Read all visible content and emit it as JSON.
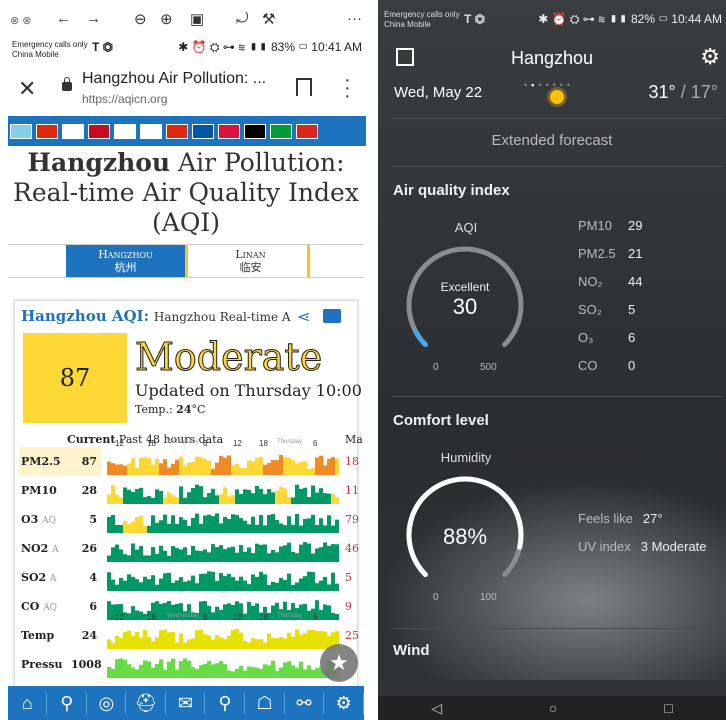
{
  "left": {
    "status": {
      "carrier_line1": "Emergency calls only",
      "carrier_line2": "China Mobile",
      "icons": "T ⏣",
      "right": "✱ ⏰ ⛭ ⊶ ≋ ▮▮ 83% ▭ 10:41 AM"
    },
    "address": {
      "title": "Hangzhou Air Pollution: ...",
      "url": "https://aqicn.org"
    },
    "flag_colors": [
      "#87ceeb",
      "#de2910",
      "#ffffff",
      "#c60b1e",
      "#ffffff",
      "#ffffff",
      "#de2910",
      "#0055a4",
      "#dc143c",
      "#000000",
      "#009c3b",
      "#da251d"
    ],
    "heading_bold": "Hangzhou",
    "heading_rest": " Air Pollution: Real-time Air Quality Index (AQI)",
    "tabs": [
      {
        "en": "Hangzhou",
        "zh": "杭州"
      },
      {
        "en": "Linan",
        "zh": "临安"
      }
    ],
    "card": {
      "title": "Hangzhou AQI:",
      "subtitle": "Hangzhou Real-time A",
      "aqi": "87",
      "level": "Moderate",
      "updated": "Updated on Thursday 10:00",
      "temp_label": "Temp.: ",
      "temp_value": "24",
      "temp_unit": "°C",
      "hist_current": "Current",
      "hist_label": "Past 48 hours data",
      "hist_max": "Ma",
      "hours": [
        "12",
        "18",
        "Wednesday",
        "6",
        "12",
        "18",
        "Thursday",
        "6"
      ],
      "rows": [
        {
          "name": "PM2.5",
          "sub": "",
          "value": "87",
          "max": "18",
          "color": "#f39c12",
          "bg": "#fff3cd"
        },
        {
          "name": "PM10",
          "sub": "",
          "value": "28",
          "max": "11",
          "color": "#009966",
          "bg": "#ffffff"
        },
        {
          "name": "O3",
          "sub": "AQ",
          "value": "5",
          "max": "79",
          "color": "#009966",
          "bg": "#ffffff"
        },
        {
          "name": "NO2",
          "sub": "A",
          "value": "26",
          "max": "46",
          "color": "#009966",
          "bg": "#ffffff"
        },
        {
          "name": "SO2",
          "sub": "A",
          "value": "4",
          "max": "5",
          "color": "#009966",
          "bg": "#ffffff"
        },
        {
          "name": "CO",
          "sub": "AQ",
          "value": "6",
          "max": "9",
          "color": "#009966",
          "bg": "#ffffff"
        },
        {
          "name": "Temp",
          "sub": "",
          "value": "24",
          "max": "25",
          "color": "#e8e000",
          "bg": "#ffffff"
        },
        {
          "name": "Pressu",
          "sub": "",
          "value": "1008",
          "max": "",
          "color": "#66dd44",
          "bg": "#ffffff"
        }
      ]
    },
    "bottom_icons": [
      "home-icon",
      "map-pin-icon",
      "globe-icon",
      "mask-icon",
      "faq-icon",
      "search-icon",
      "chat-icon",
      "link-icon",
      "gear-icon"
    ]
  },
  "right": {
    "status": {
      "carrier_line1": "Emergency calls only",
      "carrier_line2": "China Mobile",
      "icons": "T ⏣",
      "right": "✱ ⏰ ⛭ ⊶ ≋ ▮▮ 82% ▭ 10:44 AM"
    },
    "city": "Hangzhou",
    "date": "Wed, May 22",
    "high": "31°",
    "low": " / 17°",
    "extended": "Extended forecast",
    "aqi_section": "Air quality index",
    "aqi_title": "AQI",
    "aqi_level": "Excellent",
    "aqi_value": "30",
    "aqi_min": "0",
    "aqi_max": "500",
    "aqi_fraction": 0.06,
    "pollutants": [
      {
        "k": "PM10",
        "v": "29"
      },
      {
        "k": "PM2.5",
        "v": "21"
      },
      {
        "k": "NO₂",
        "v": "44"
      },
      {
        "k": "SO₂",
        "v": "5"
      },
      {
        "k": "O₃",
        "v": "6"
      },
      {
        "k": "CO",
        "v": "0"
      }
    ],
    "comfort_section": "Comfort level",
    "humidity_title": "Humidity",
    "humidity_value": "88%",
    "humidity_min": "0",
    "humidity_max": "100",
    "humidity_fraction": 0.88,
    "feels_label": "Feels like",
    "feels_value": "27°",
    "uv_label": "UV index",
    "uv_value": "3  Moderate",
    "wind_section": "Wind",
    "nav": [
      "◁",
      "○",
      "□"
    ]
  }
}
